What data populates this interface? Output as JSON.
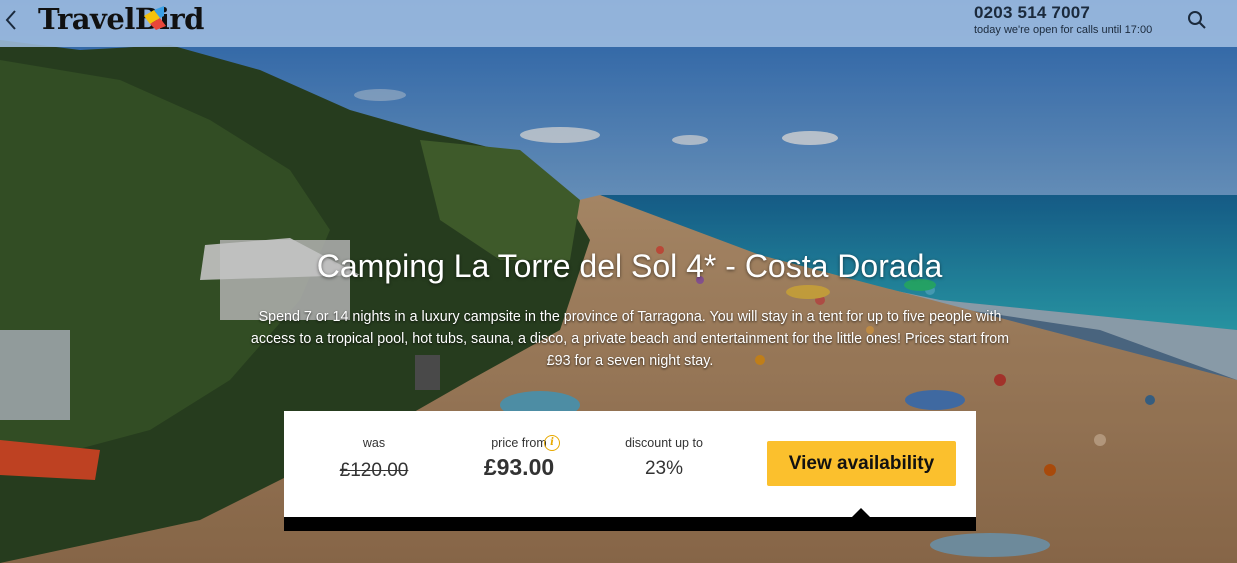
{
  "header": {
    "logo_text": "TravelBird",
    "phone": "0203 514 7007",
    "phone_note": "today we're open for calls until 17:00",
    "back_icon": "chevron-left-icon",
    "search_icon": "search-icon"
  },
  "hero": {
    "title": "Camping La Torre del Sol 4* - Costa Dorada",
    "description": "Spend 7 or 14 nights in a luxury campsite in the province of Tarragona. You will stay in a tent for up to five people with access to a tropical pool, hot tubs, sauna, a disco, a private beach and entertainment for the little ones! Prices start from £93 for a seven night stay."
  },
  "pricing": {
    "was_label": "was",
    "was_value": "£120.00",
    "price_from_label": "price from",
    "price_from_value": "£93.00",
    "info_icon": "info-icon",
    "discount_label": "discount up to",
    "discount_value": "23%",
    "cta_label": "View availability"
  },
  "colors": {
    "accent": "#fbc02d",
    "topbar": "#a0bee1",
    "info": "#e8a900"
  }
}
